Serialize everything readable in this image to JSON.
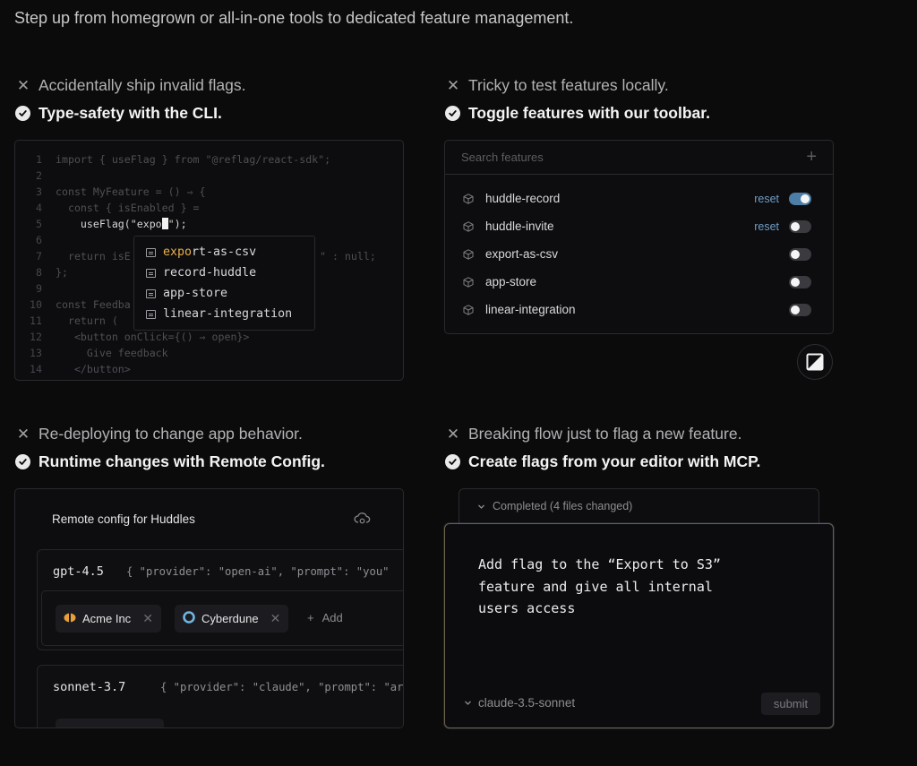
{
  "intro": "Step up from homegrown or all-in-one tools to dedicated feature management.",
  "sections": {
    "cli": {
      "pain": "Accidentally ship invalid flags.",
      "gain": "Type-safety with the CLI."
    },
    "toolbar": {
      "pain": "Tricky to test features locally.",
      "gain": "Toggle features with our toolbar."
    },
    "remote": {
      "pain": "Re-deploying to change app behavior.",
      "gain": "Runtime changes with Remote Config."
    },
    "mcp": {
      "pain": "Breaking flow just to flag a new feature.",
      "gain": "Create flags from your editor with MCP."
    }
  },
  "code": {
    "line_numbers": [
      "1",
      "2",
      "3",
      "4",
      "5",
      "6",
      "7",
      "8",
      "9",
      "10",
      "11",
      "12",
      "13",
      "14"
    ],
    "lines": [
      "import { useFlag } from \"@reflag/react-sdk\";",
      "",
      "const MyFeature = () ⇒ {",
      "  const { isEnabled } =",
      "",
      "",
      "  return isE",
      "};",
      "",
      "const Feedba",
      "  return (",
      "   <button onClick={() ⇒ open}>",
      "     Give feedback",
      "   </button>"
    ],
    "line5_prefix": "    useFlag(\"expo",
    "line5_suffix": "\");",
    "line7_tail": "\" : null;",
    "autocomplete_match": "expo",
    "autocomplete": [
      "export-as-csv",
      "record-huddle",
      "app-store",
      "linear-integration"
    ],
    "autocomplete_rest": [
      "rt-as-csv"
    ]
  },
  "toolbar": {
    "search_placeholder": "Search features",
    "add_glyph": "+",
    "features": [
      {
        "name": "huddle-record",
        "reset": "reset",
        "enabled": true
      },
      {
        "name": "huddle-invite",
        "reset": "reset",
        "enabled": false
      },
      {
        "name": "export-as-csv",
        "reset": "",
        "enabled": false
      },
      {
        "name": "app-store",
        "reset": "",
        "enabled": false
      },
      {
        "name": "linear-integration",
        "reset": "",
        "enabled": false
      }
    ]
  },
  "remote": {
    "title": "Remote config for Huddles",
    "configs": [
      {
        "key": "gpt-4.5",
        "value": "{ \"provider\": \"open-ai\", \"prompt\": \"you\""
      },
      {
        "key": "sonnet-3.7",
        "value": "{ \"provider\": \"claude\", \"prompt\": \"ar"
      }
    ],
    "chips": [
      "Acme Inc",
      "Cyberdune"
    ],
    "add_label": "Add"
  },
  "mcp": {
    "completed": "Completed (4 files changed)",
    "prompt_lines": [
      "Add flag to the “Export to S3”",
      "feature and give all internal",
      "users access"
    ],
    "model": "claude-3.5-sonnet",
    "submit": "submit"
  }
}
